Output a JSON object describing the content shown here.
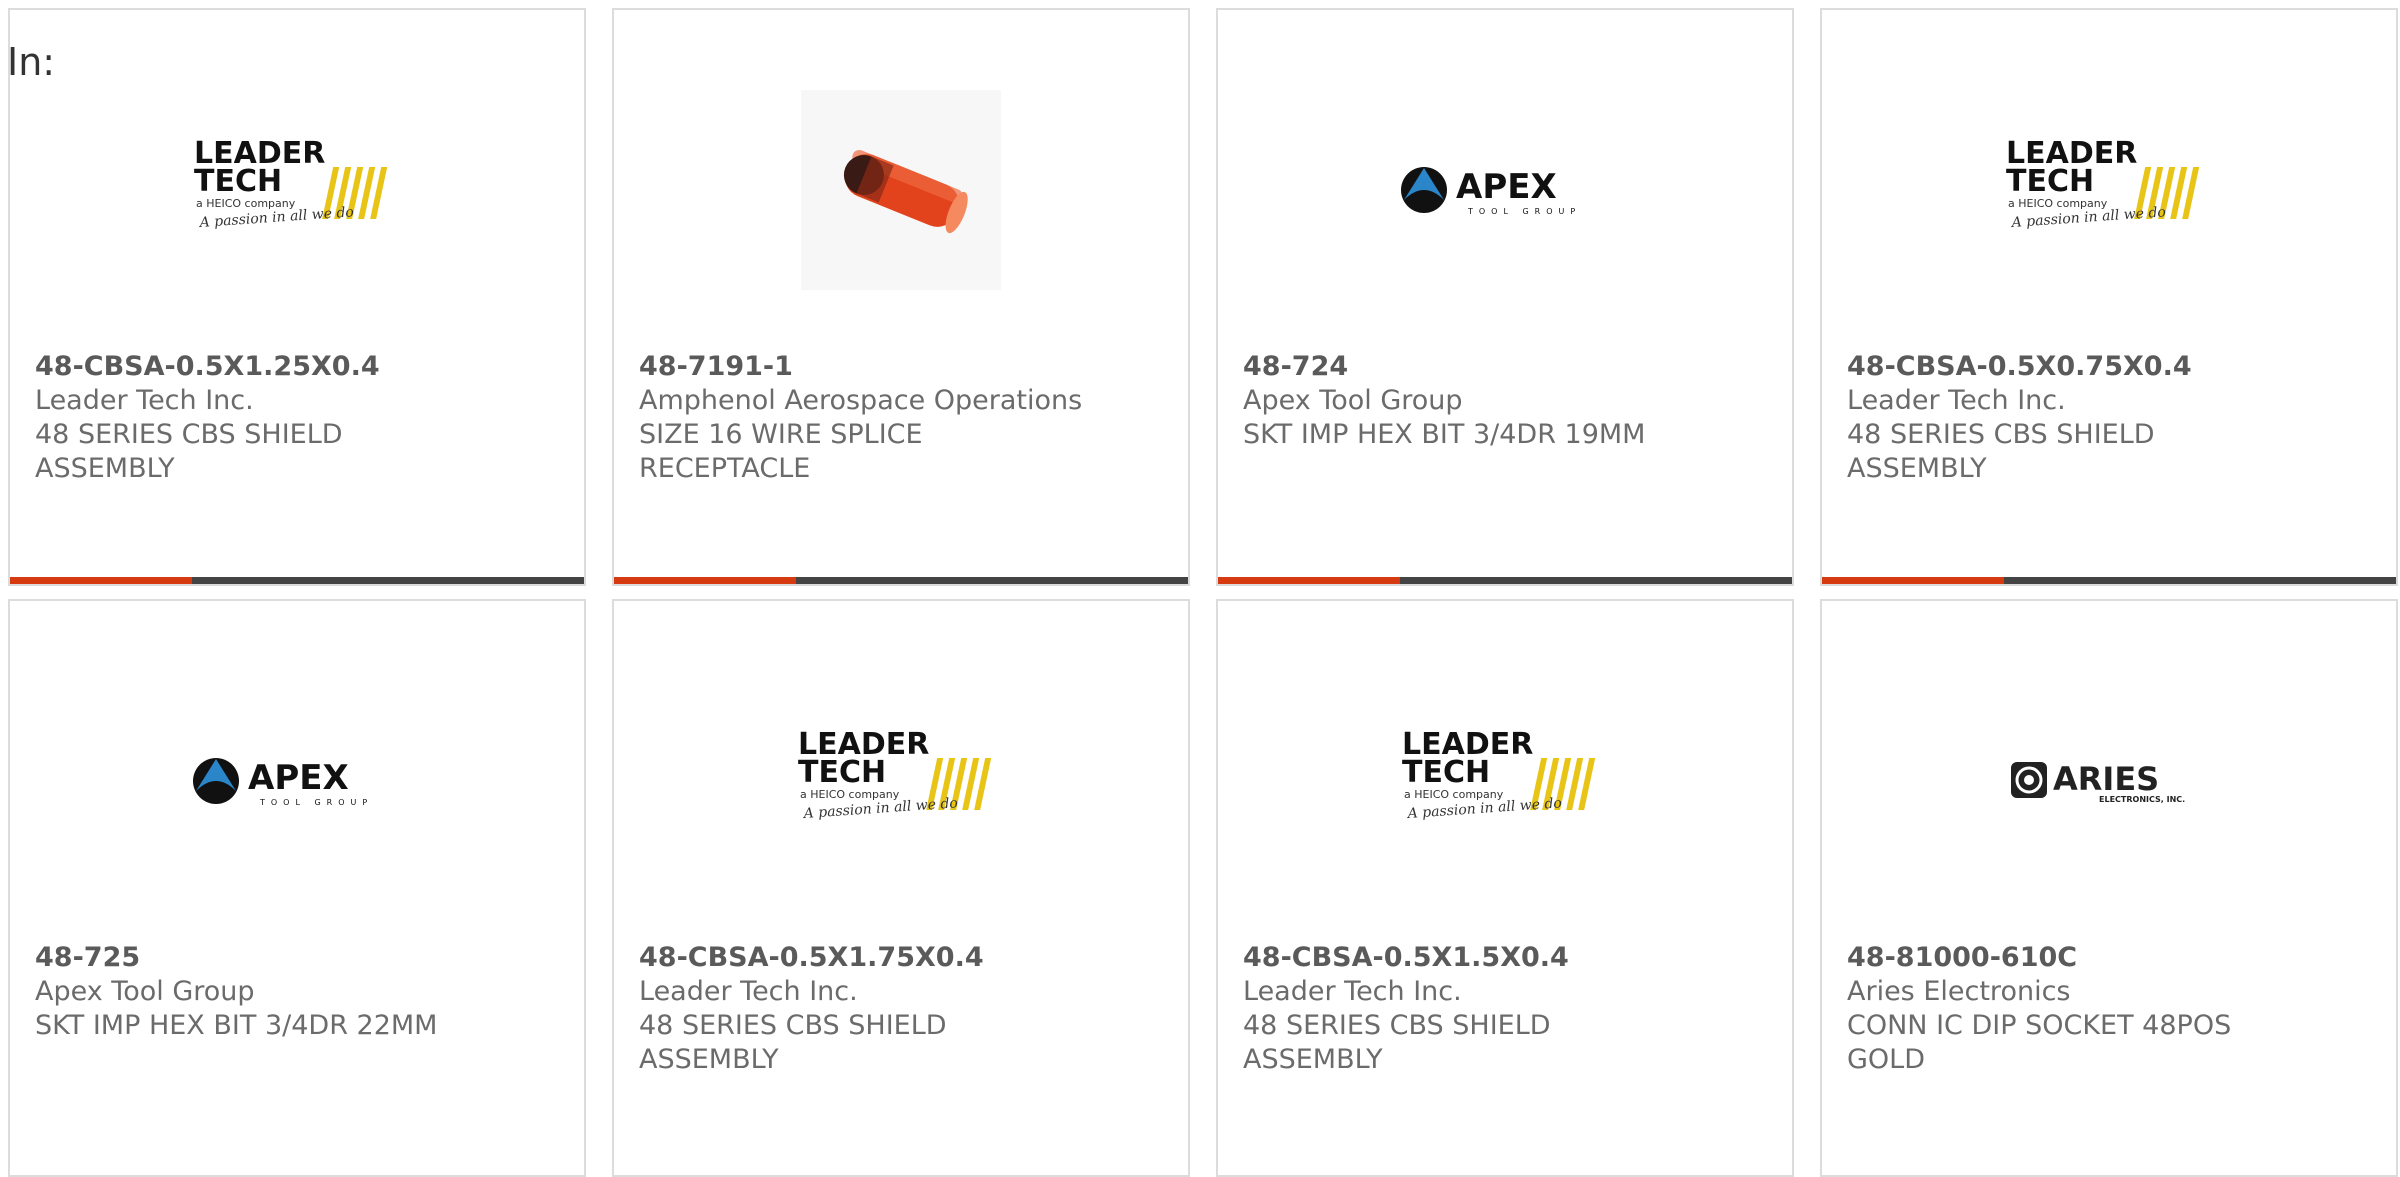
{
  "header": {
    "label": "In:"
  },
  "colors": {
    "accent": "#d63a10",
    "bar": "#444444",
    "leader_yellow": "#e8c417",
    "apex_blue": "#2a86c8"
  },
  "products": [
    {
      "part_number": "48-CBSA-0.5X1.25X0.4",
      "manufacturer": "Leader Tech Inc.",
      "desc1": "48 SERIES CBS SHIELD",
      "desc2": "ASSEMBLY",
      "logo": "leader-tech-logo"
    },
    {
      "part_number": "48-7191-1",
      "manufacturer": "Amphenol Aerospace Operations",
      "desc1": "SIZE 16 WIRE SPLICE",
      "desc2": "RECEPTACLE",
      "logo": "wire-splice-photo"
    },
    {
      "part_number": "48-724",
      "manufacturer": "Apex Tool Group",
      "desc1": "SKT IMP HEX BIT 3/4DR 19MM",
      "desc2": "",
      "logo": "apex-logo"
    },
    {
      "part_number": "48-CBSA-0.5X0.75X0.4",
      "manufacturer": "Leader Tech Inc.",
      "desc1": "48 SERIES CBS SHIELD",
      "desc2": "ASSEMBLY",
      "logo": "leader-tech-logo"
    },
    {
      "part_number": "48-725",
      "manufacturer": "Apex Tool Group",
      "desc1": "SKT IMP HEX BIT 3/4DR 22MM",
      "desc2": "",
      "logo": "apex-logo"
    },
    {
      "part_number": "48-CBSA-0.5X1.75X0.4",
      "manufacturer": "Leader Tech Inc.",
      "desc1": "48 SERIES CBS SHIELD",
      "desc2": "ASSEMBLY",
      "logo": "leader-tech-logo"
    },
    {
      "part_number": "48-CBSA-0.5X1.5X0.4",
      "manufacturer": "Leader Tech Inc.",
      "desc1": "48 SERIES CBS SHIELD",
      "desc2": "ASSEMBLY",
      "logo": "leader-tech-logo"
    },
    {
      "part_number": "48-81000-610C",
      "manufacturer": "Aries Electronics",
      "desc1": "CONN IC DIP SOCKET 48POS",
      "desc2": "GOLD",
      "logo": "aries-logo"
    }
  ],
  "logos": {
    "leader": {
      "line1": "LEADER",
      "line2": "TECH",
      "sub": "a HEICO company",
      "tagline": "A passion in all we do"
    },
    "apex": {
      "name": "APEX",
      "sub": "TOOL GROUP"
    },
    "aries": {
      "name": "ARIES",
      "sub": "ELECTRONICS, INC."
    }
  }
}
